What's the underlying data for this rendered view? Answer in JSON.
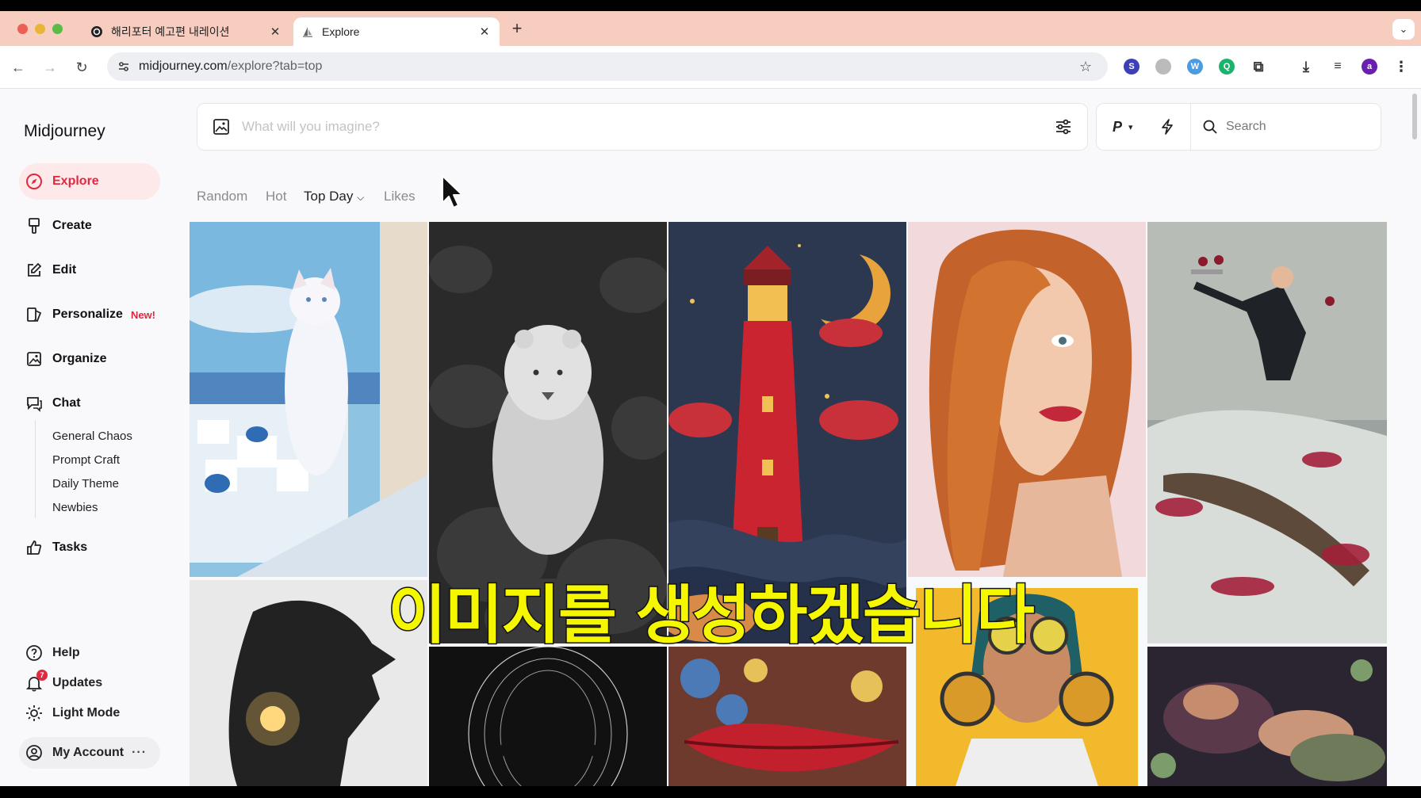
{
  "browser": {
    "tabs": [
      {
        "title": "해리포터 예고편 내레이션",
        "active": false
      },
      {
        "title": "Explore",
        "active": true
      }
    ],
    "url_host": "midjourney.com",
    "url_path": "/explore?tab=top",
    "profile_initial": "a"
  },
  "sidebar": {
    "brand": "Midjourney",
    "items": [
      {
        "label": "Explore",
        "icon": "compass-icon",
        "active": true
      },
      {
        "label": "Create",
        "icon": "brush-icon"
      },
      {
        "label": "Edit",
        "icon": "edit-icon"
      },
      {
        "label": "Personalize",
        "icon": "personalize-icon",
        "badge": "New!"
      },
      {
        "label": "Organize",
        "icon": "image-icon"
      },
      {
        "label": "Chat",
        "icon": "chat-icon"
      }
    ],
    "chat_rooms": [
      "General Chaos",
      "Prompt Craft",
      "Daily Theme",
      "Newbies"
    ],
    "tasks": "Tasks",
    "help": "Help",
    "updates": "Updates",
    "updates_count": "7",
    "light_mode": "Light Mode",
    "account": "My Account",
    "account_more": "···"
  },
  "prompt": {
    "placeholder": "What will you imagine?",
    "p_label": "P",
    "search_placeholder": "Search"
  },
  "filters": [
    "Random",
    "Hot",
    "Top Day",
    "Likes"
  ],
  "active_filter": "Top Day",
  "subtitle": "이미지를 생성하겠습니다",
  "colors": {
    "accent": "#e0283f",
    "subtitle": "#f5f700"
  }
}
